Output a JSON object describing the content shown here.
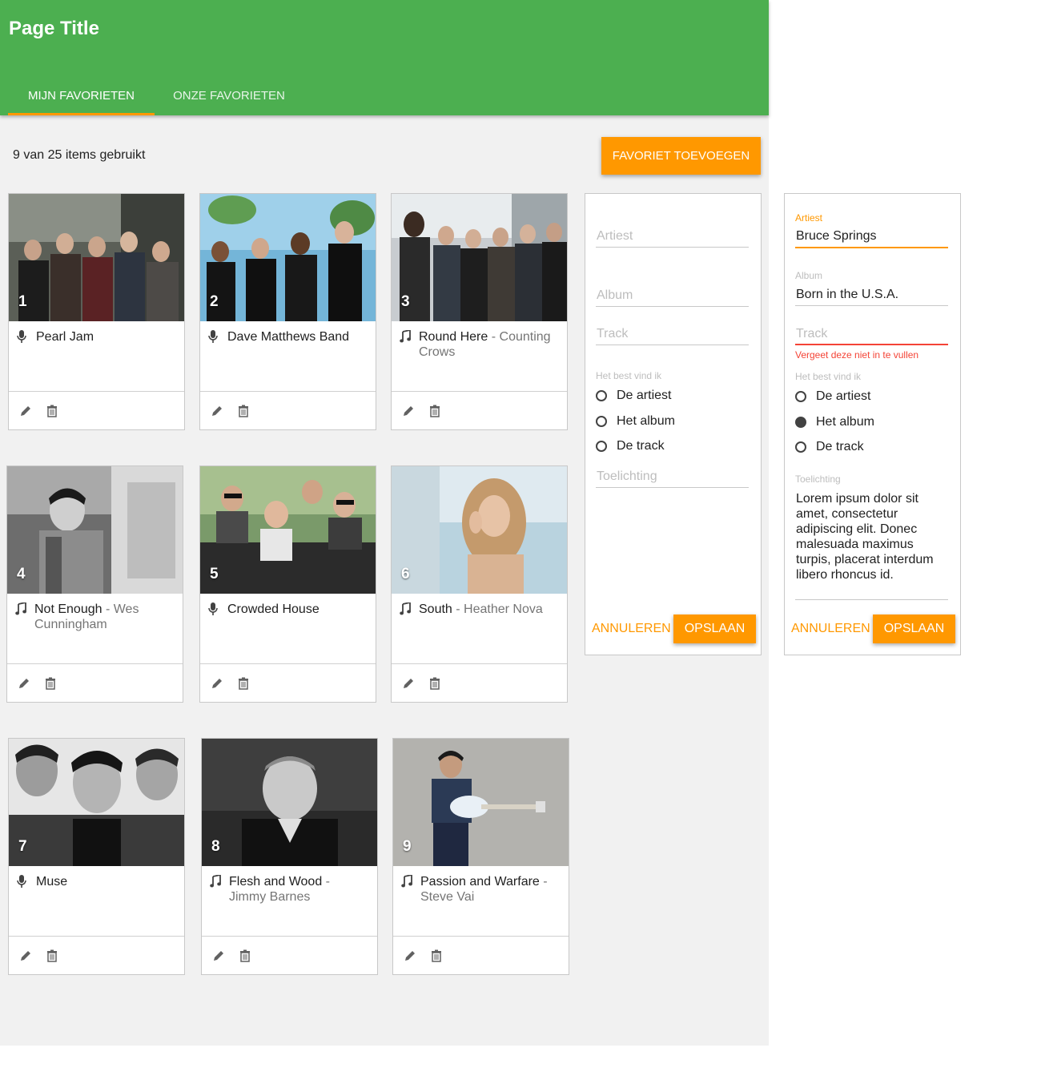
{
  "header": {
    "title": "Page Title",
    "tabs": [
      {
        "label": "MIJN FAVORIETEN",
        "active": true
      },
      {
        "label": "ONZE FAVORIETEN",
        "active": false
      }
    ]
  },
  "toolbar": {
    "usage_text": "9 van 25 items gebruikt",
    "add_label": "FAVORIET TOEVOEGEN"
  },
  "favorites": [
    {
      "number": "1",
      "type": "artist",
      "title": "Pearl Jam",
      "subtitle": ""
    },
    {
      "number": "2",
      "type": "artist",
      "title": "Dave Matthews Band",
      "subtitle": ""
    },
    {
      "number": "3",
      "type": "track",
      "title": "Round Here",
      "subtitle": "- Counting Crows"
    },
    {
      "number": "4",
      "type": "track",
      "title": "Not Enough",
      "subtitle": "- Wes Cunningham"
    },
    {
      "number": "5",
      "type": "artist",
      "title": "Crowded House",
      "subtitle": ""
    },
    {
      "number": "6",
      "type": "track",
      "title": "South",
      "subtitle": "- Heather Nova"
    },
    {
      "number": "7",
      "type": "artist",
      "title": "Muse",
      "subtitle": ""
    },
    {
      "number": "8",
      "type": "track",
      "title": "Flesh and Wood",
      "subtitle": "- Jimmy Barnes"
    },
    {
      "number": "9",
      "type": "track",
      "title": "Passion and Warfare",
      "subtitle": "- Steve Vai"
    }
  ],
  "form_empty": {
    "artist_placeholder": "Artiest",
    "album_placeholder": "Album",
    "track_placeholder": "Track",
    "preference_label": "Het best vind ik",
    "options": [
      "De artiest",
      "Het album",
      "De track"
    ],
    "selected": null,
    "note_placeholder": "Toelichting",
    "cancel_label": "ANNULEREN",
    "save_label": "OPSLAAN"
  },
  "form_filled": {
    "artist_label": "Artiest",
    "artist_value": "Bruce Springs",
    "album_label": "Album",
    "album_value": "Born in the U.S.A.",
    "track_placeholder": "Track",
    "track_error": "Vergeet deze niet in te vullen",
    "preference_label": "Het best vind ik",
    "options": [
      "De artiest",
      "Het album",
      "De track"
    ],
    "selected": "Het album",
    "note_label": "Toelichting",
    "note_value": "Lorem ipsum dolor sit amet, consectetur adipiscing elit. Donec malesuada maximus turpis, placerat interdum libero rhoncus id.",
    "cancel_label": "ANNULEREN",
    "save_label": "OPSLAAN"
  },
  "colors": {
    "primary": "#4caf50",
    "accent": "#ff9800",
    "error": "#f44336",
    "text_secondary": "#757575",
    "icons": {
      "artist": "microphone-icon",
      "track": "music-note-icon",
      "edit": "pencil-icon",
      "delete": "trash-icon"
    }
  }
}
